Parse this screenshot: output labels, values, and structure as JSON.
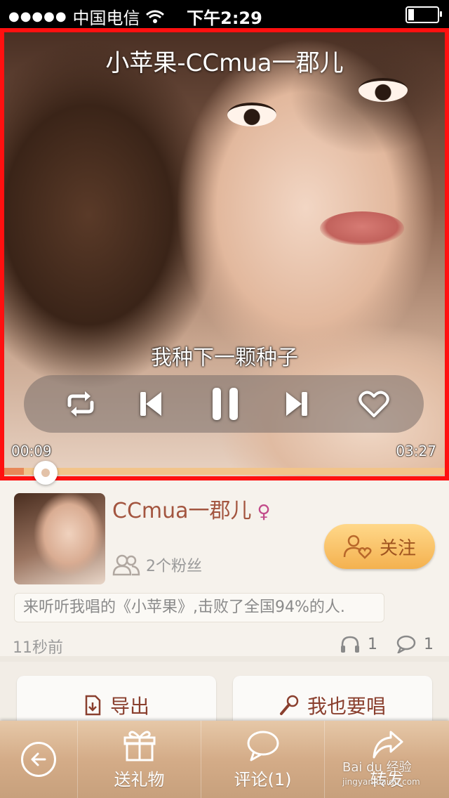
{
  "status_bar": {
    "signal": "●●●●●",
    "carrier": "中国电信",
    "time": "下午2:29"
  },
  "player": {
    "title": "小苹果-CCmua一郡儿",
    "lyric": "我种下一颗种子",
    "current_time": "00:09",
    "total_time": "03:27",
    "progress_fraction": 0.045,
    "state": "playing",
    "controls": [
      "repeat-icon",
      "previous-icon",
      "pause-icon",
      "next-icon",
      "heart-icon"
    ]
  },
  "user": {
    "name": "CCmua一郡儿",
    "gender_symbol": "♀",
    "fans": "2个粉丝",
    "follow_label": "关注",
    "brag_text": "来听听我唱的《小苹果》,击败了全国94%的人.",
    "posted": "11秒前",
    "listens": "1",
    "comments": "1"
  },
  "actions": {
    "export_label": "导出",
    "sing_label": "我也要唱"
  },
  "tabbar": {
    "gift_label": "送礼物",
    "comment_label": "评论(1)",
    "share_label": "转发"
  },
  "watermark": {
    "brand": "Bai du 经验",
    "url": "jingyan.baidu.com"
  },
  "colors": {
    "highlight_border": "#ff1010",
    "name_color": "#a3553f",
    "follow_button": "#f4b14f"
  }
}
